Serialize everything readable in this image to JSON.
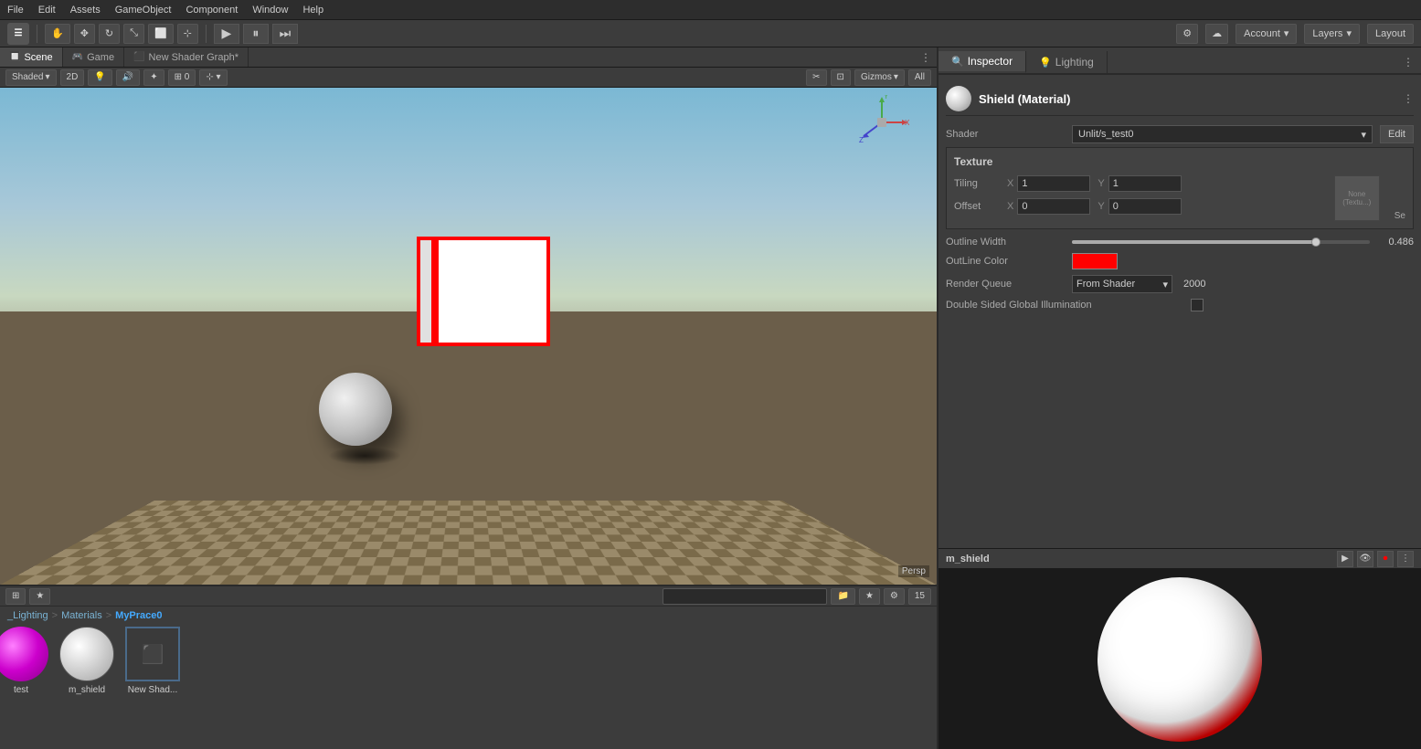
{
  "topMenu": {
    "items": [
      "File",
      "Edit",
      "Assets",
      "GameObject",
      "Component",
      "Window",
      "Help"
    ]
  },
  "toolbar": {
    "unityLogo": "☰",
    "playLabel": "▶",
    "pauseLabel": "⏸",
    "stepLabel": "⏭",
    "accountLabel": "Account",
    "layersLabel": "Layers",
    "layoutLabel": "Layout",
    "settingsIcon": "⚙",
    "cloudIcon": "☁"
  },
  "sceneTabs": {
    "tabs": [
      {
        "label": "Scene",
        "icon": "🔲",
        "active": true
      },
      {
        "label": "Game",
        "icon": "🎮",
        "active": false
      },
      {
        "label": "New Shader Graph*",
        "icon": "⬛",
        "active": false
      }
    ],
    "moreLabel": "⋮"
  },
  "sceneToolbar": {
    "shadedLabel": "Shaded",
    "twoDLabel": "2D",
    "gizmosLabel": "Gizmos",
    "allLabel": "All"
  },
  "inspector": {
    "tabs": [
      {
        "label": "Inspector",
        "icon": "🔍",
        "active": true
      },
      {
        "label": "Lighting",
        "icon": "💡",
        "active": false
      }
    ],
    "materialTitle": "Shield (Material)",
    "shaderLabel": "Shader",
    "shaderValue": "Unlit/s_test0",
    "editLabel": "Edit",
    "textureSection": {
      "header": "Texture",
      "noneLabel": "None\n(Textu...",
      "setLabel": "Se",
      "tilingLabel": "Tiling",
      "offsetLabel": "Offset",
      "tilingX": "1",
      "tilingY": "1",
      "offsetX": "0",
      "offsetY": "0"
    },
    "outlineWidth": {
      "label": "Outline Width",
      "value": "0.486",
      "sliderPercent": 82
    },
    "outlineColor": {
      "label": "OutLine Color",
      "color": "#ff0000"
    },
    "renderQueue": {
      "label": "Render Queue",
      "dropdown": "From Shader",
      "value": "2000"
    },
    "doubleSided": {
      "label": "Double Sided Global Illumination"
    },
    "previewName": "m_shield"
  },
  "bottomPanel": {
    "breadcrumb": {
      "items": [
        "_Lighting",
        "Materials",
        "MyPrace0"
      ],
      "separator": ">"
    },
    "searchPlaceholder": "",
    "assets": [
      {
        "label": "test",
        "type": "pink-sphere"
      },
      {
        "label": "m_shield",
        "type": "white-sphere"
      },
      {
        "label": "New Shad...",
        "type": "shader"
      }
    ]
  }
}
